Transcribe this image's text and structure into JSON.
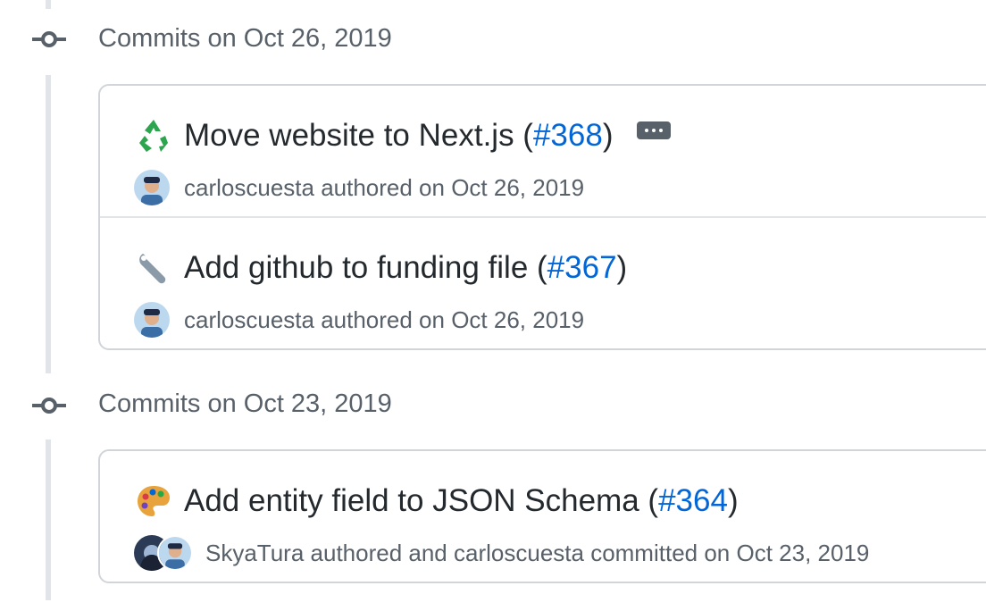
{
  "groups": [
    {
      "title": "Commits on Oct 26, 2019",
      "commits": [
        {
          "emoji": "recycle-icon",
          "message": "Move website to Next.js (",
          "pr": "#368",
          "message_end": ")",
          "has_ellipsis": true,
          "author": "carloscuesta",
          "meta": " authored on Oct 26, 2019"
        },
        {
          "emoji": "wrench-icon",
          "message": "Add github to funding file (",
          "pr": "#367",
          "message_end": ")",
          "has_ellipsis": false,
          "author": "carloscuesta",
          "meta": " authored on Oct 26, 2019"
        }
      ]
    },
    {
      "title": "Commits on Oct 23, 2019",
      "commits": [
        {
          "emoji": "art-palette-icon",
          "message": "Add entity field to JSON Schema (",
          "pr": "#364",
          "message_end": ")",
          "has_ellipsis": false,
          "author": "SkyaTura",
          "meta": " authored and ",
          "committer": "carloscuesta",
          "meta2": " committed on Oct 23, 2019"
        }
      ]
    }
  ],
  "colors": {
    "link": "#0366d6",
    "muted": "#586069",
    "border": "#d1d5da",
    "timeline": "#e1e4e8"
  }
}
